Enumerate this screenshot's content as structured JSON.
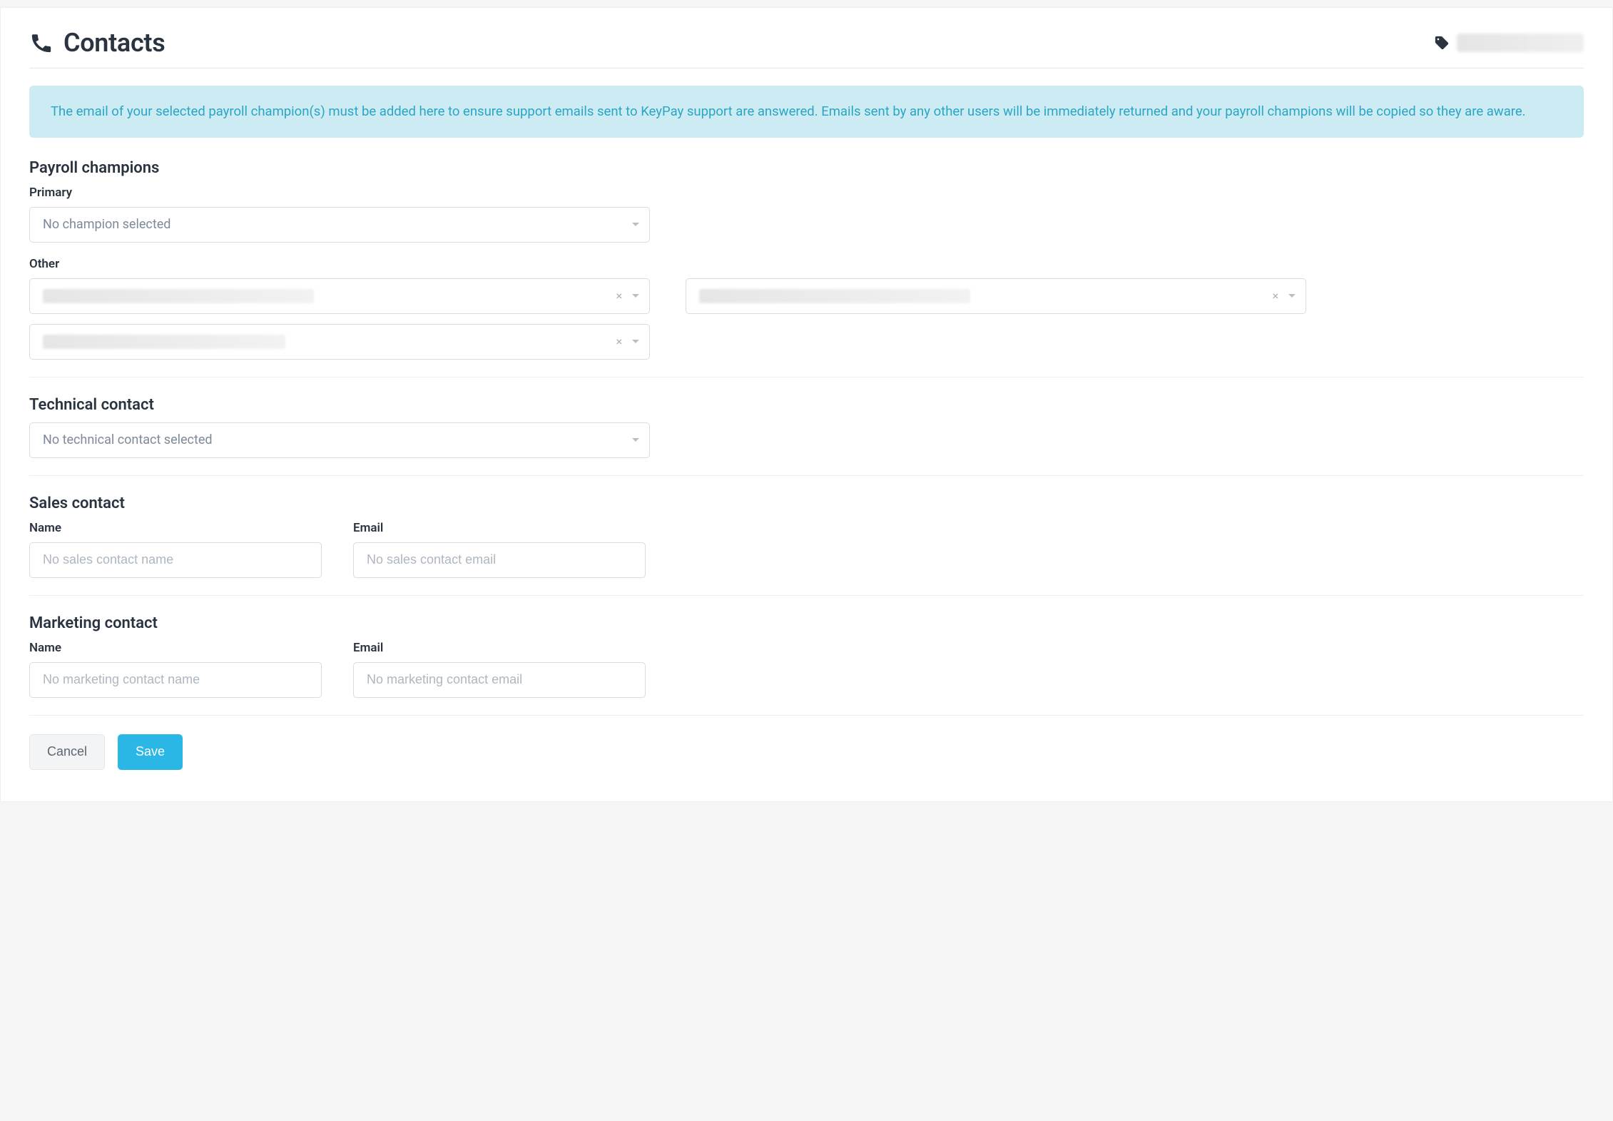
{
  "header": {
    "title": "Contacts"
  },
  "banner": {
    "text": "The email of your selected payroll champion(s) must be added here to ensure support emails sent to KeyPay support are answered. Emails sent by any other users will be immediately returned and your payroll champions will be copied so they are aware."
  },
  "sections": {
    "payroll_champions": {
      "heading": "Payroll champions",
      "primary_label": "Primary",
      "primary_placeholder": "No champion selected",
      "other_label": "Other"
    },
    "technical": {
      "heading": "Technical contact",
      "placeholder": "No technical contact selected"
    },
    "sales": {
      "heading": "Sales contact",
      "name_label": "Name",
      "email_label": "Email",
      "name_placeholder": "No sales contact name",
      "email_placeholder": "No sales contact email"
    },
    "marketing": {
      "heading": "Marketing contact",
      "name_label": "Name",
      "email_label": "Email",
      "name_placeholder": "No marketing contact name",
      "email_placeholder": "No marketing contact email"
    }
  },
  "actions": {
    "cancel": "Cancel",
    "save": "Save"
  },
  "glyphs": {
    "clear": "×"
  }
}
